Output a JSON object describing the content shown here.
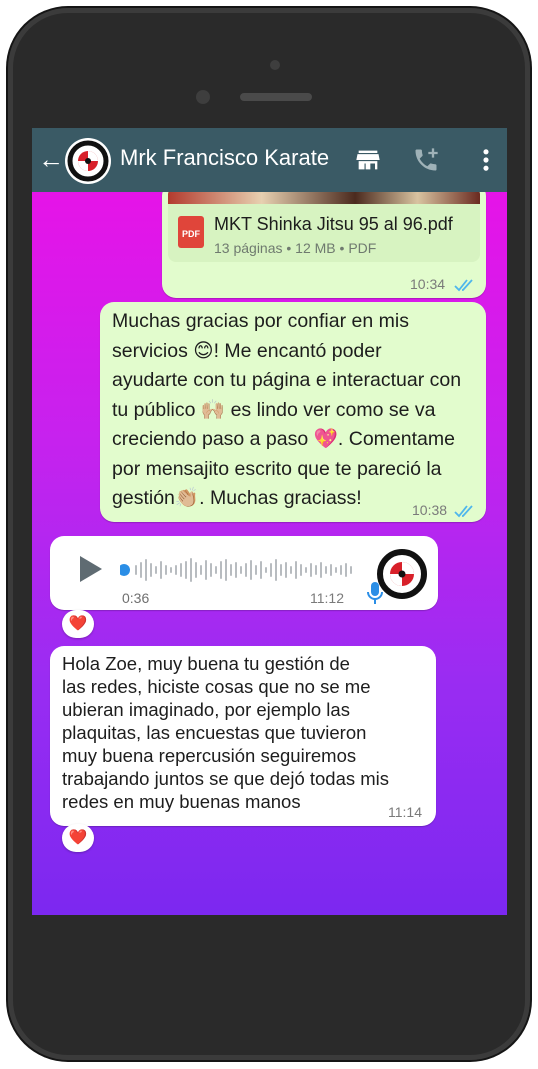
{
  "header": {
    "back_glyph": "←",
    "contact_name": "Mrk Francisco Karate",
    "icons": [
      "shop-icon",
      "add-call-icon",
      "more-vert-icon"
    ]
  },
  "document_message": {
    "file_name": "MKT Shinka Jitsu 95 al 96.pdf",
    "meta": "13 páginas • 12 MB • PDF",
    "pdf_label": "PDF",
    "time": "10:34"
  },
  "outgoing_message": {
    "lines": [
      "Muchas gracias por confiar en mis",
      "servicios 😊! Me encantó poder",
      "ayudarte con tu página e interactuar con",
      "tu público 🙌🏼 es lindo ver como se va",
      "creciendo paso a paso 💖. Comentame",
      "por mensajito escrito que te pareció la",
      "gestión👏🏼. Muchas graciass!"
    ],
    "time": "10:38"
  },
  "voice_message": {
    "duration": "0:36",
    "time": "11:12",
    "reaction": "❤️"
  },
  "incoming_message": {
    "lines": [
      "Hola Zoe, muy buena tu gestión de",
      "las redes, hiciste cosas que no se me",
      "ubieran imaginado, por ejemplo las",
      "plaquitas, las encuestas que tuvieron",
      "muy buena repercusión seguiremos",
      "trabajando juntos se que dejó todas mis",
      "redes en muy buenas manos"
    ],
    "time": "11:14",
    "reaction": "❤️"
  },
  "colors": {
    "header_bg": "#3a5a65",
    "outgoing_bubble": "#e2fccd",
    "incoming_bubble": "#ffffff",
    "read_ticks": "#4fb6ec",
    "gradient_top": "#ee10e6",
    "gradient_bottom": "#7c28f0"
  }
}
